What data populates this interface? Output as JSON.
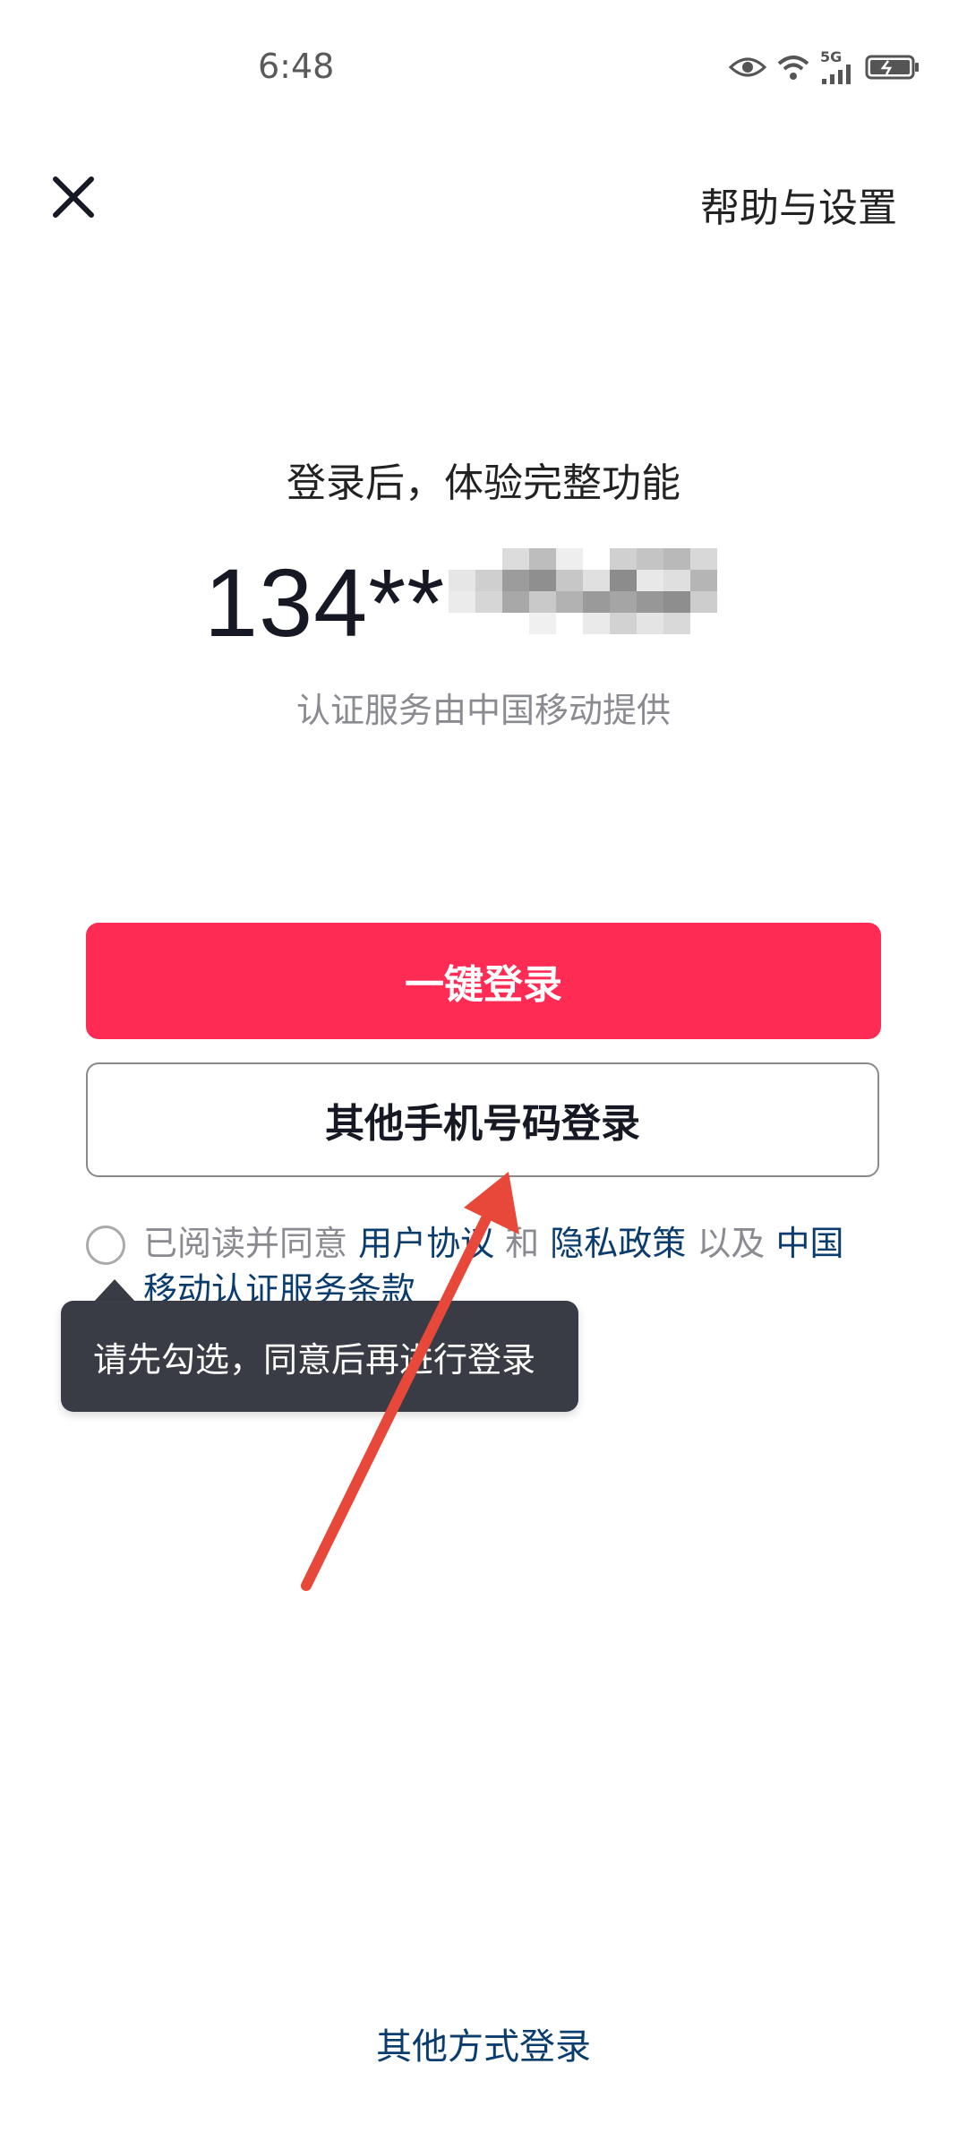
{
  "status_bar": {
    "time": "6:48",
    "network_label": "5G",
    "icons": [
      "eye-icon",
      "wifi-icon",
      "signal-icon",
      "battery-icon"
    ]
  },
  "top_bar": {
    "close_icon": "close-icon",
    "help_label": "帮助与设置"
  },
  "main": {
    "subtitle": "登录后，体验完整功能",
    "phone_number_visible": "134**",
    "provider_note": "认证服务由中国移动提供",
    "primary_button": "一键登录",
    "secondary_button": "其他手机号码登录"
  },
  "agreement": {
    "prefix": "已阅读并同意 ",
    "user_agreement": "用户协议",
    "and": " 和 ",
    "privacy_policy": "隐私政策",
    "and_also": " 以及 ",
    "cmcc_terms": "中国移动认证服务条款",
    "checked": false
  },
  "tooltip": {
    "text": "请先勾选，同意后再进行登录"
  },
  "footer": {
    "other_login": "其他方式登录"
  },
  "colors": {
    "primary": "#fe2c55",
    "link": "#0b3c6e",
    "tooltip_bg": "#3a3c45",
    "annotation_arrow": "#e8483a"
  }
}
